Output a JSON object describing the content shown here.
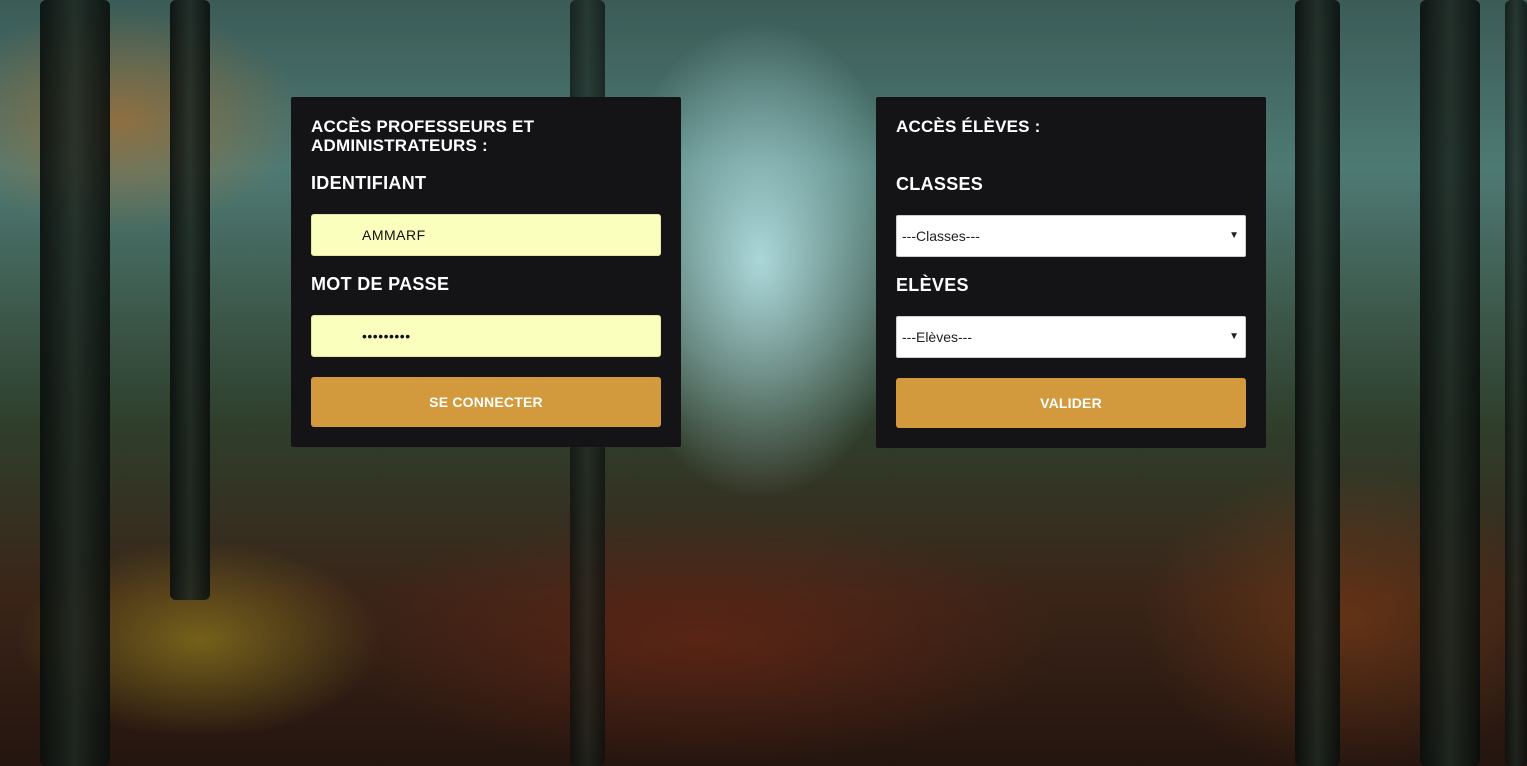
{
  "teacher_login": {
    "title": "ACCÈS PROFESSEURS ET ADMINISTRATEURS :",
    "identifier_label": "IDENTIFIANT",
    "identifier_value": "AMMARF",
    "password_label": "MOT DE PASSE",
    "password_value": "*********",
    "submit_label": "SE CONNECTER"
  },
  "student_access": {
    "title": "ACCÈS ÉLÈVES :",
    "classes_label": "CLASSES",
    "classes_selected": "---Classes---",
    "students_label": "ELÈVES",
    "students_selected": "---Elèves---",
    "submit_label": "VALIDER"
  },
  "colors": {
    "panel_background": "#141416",
    "button_background": "#d29a3c",
    "input_autofill": "#fbffbd"
  }
}
